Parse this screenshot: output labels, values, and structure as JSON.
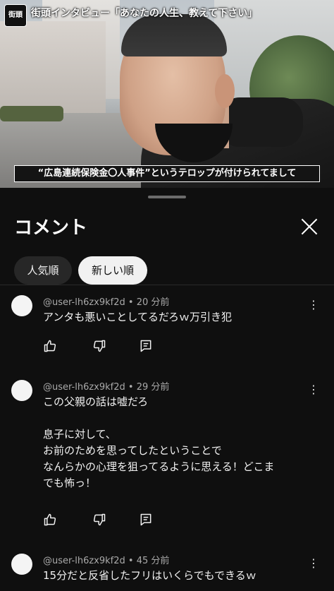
{
  "video": {
    "channel_logo_text": "街頭",
    "title": "街頭インタビュー「あなたの人生、教えて下さい」",
    "subtitle": "“広島連続保険金〇人事件”というテロップが付けられてまして"
  },
  "sheet": {
    "title": "コメント",
    "close_icon": "close-icon",
    "chips": [
      {
        "label": "人気順",
        "selected": false
      },
      {
        "label": "新しい順",
        "selected": true
      }
    ]
  },
  "comments": [
    {
      "author": "@user-lh6zx9kf2d",
      "time": "20 分前",
      "text": "アンタも悪いことしてるだろｗ万引き犯"
    },
    {
      "author": "@user-lh6zx9kf2d",
      "time": "29 分前",
      "text": "この父親の話は嘘だろ\n\n息子に対して、\nお前のためを思ってしたということで\nなんらかの心理を狙ってるように思える！どこま\nでも怖っ！"
    },
    {
      "author": "@user-lh6zx9kf2d",
      "time": "45 分前",
      "text": "15分だと反省したフリはいくらでもできるｗ"
    }
  ],
  "colors": {
    "background": "#0f0f0f",
    "chip_selected_bg": "#f1f1f1",
    "chip_bg": "#272727",
    "meta_text": "#aaaaaa"
  }
}
